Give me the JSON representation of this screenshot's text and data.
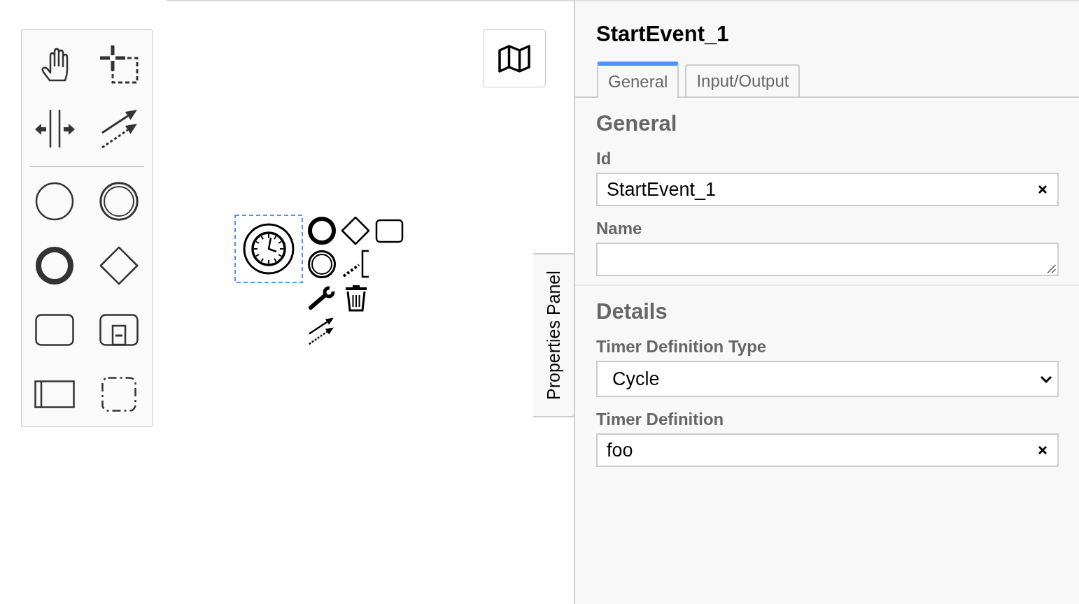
{
  "diagram": {
    "elements": [
      {
        "kind": "timer-start-event",
        "selected": true
      }
    ]
  },
  "panel_toggle": {
    "label": "Properties Panel"
  },
  "properties_panel": {
    "title": "StartEvent_1",
    "tabs": [
      {
        "label": "General",
        "selected": true
      },
      {
        "label": "Input/Output",
        "selected": false
      }
    ],
    "groups": [
      {
        "title": "General",
        "fields": [
          {
            "kind": "text",
            "label": "Id",
            "value": "StartEvent_1"
          },
          {
            "kind": "textarea",
            "label": "Name"
          }
        ]
      },
      {
        "title": "Details",
        "fields": [
          {
            "kind": "select",
            "label": "Timer Definition Type",
            "value": "Cycle"
          },
          {
            "kind": "text",
            "label": "Timer Definition",
            "value": "foo"
          }
        ]
      }
    ]
  }
}
